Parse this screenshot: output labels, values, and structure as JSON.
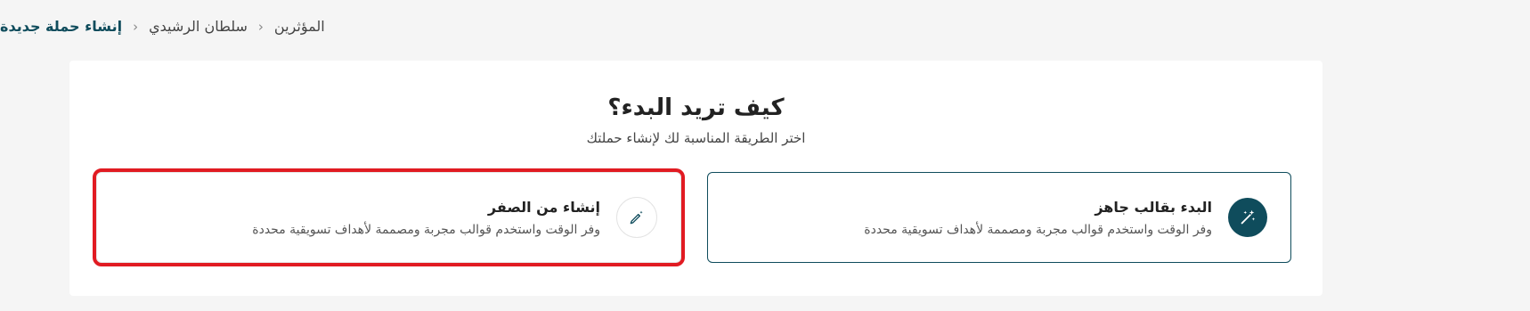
{
  "breadcrumb": {
    "items": [
      "المؤثرين",
      "سلطان الرشيدي",
      "إنشاء حملة جديدة"
    ]
  },
  "main": {
    "heading": "كيف تريد البدء؟",
    "subheading": "اختر الطريقة المناسبة لك لإنشاء حملتك",
    "options": [
      {
        "title": "البدء بقالب جاهز",
        "description": "وفر الوقت واستخدم قوالب مجربة ومصممة لأهداف تسويقية محددة",
        "icon": "magic-wand-icon"
      },
      {
        "title": "إنشاء من الصفر",
        "description": "وفر الوقت واستخدم قوالب مجربة ومصممة لأهداف تسويقية محددة",
        "icon": "pen-sparkle-icon"
      }
    ]
  },
  "colors": {
    "accent": "#0f4c5c",
    "highlight": "#e11b22",
    "background": "#f5f5f5"
  }
}
